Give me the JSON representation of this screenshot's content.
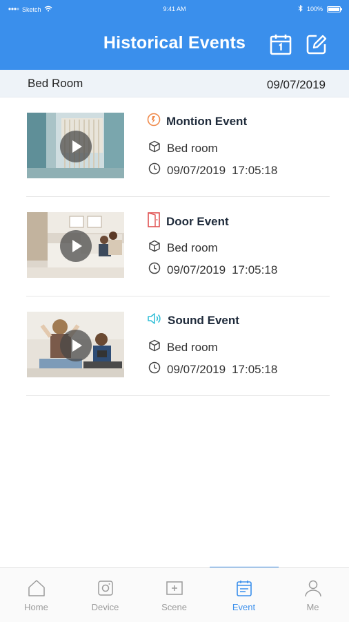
{
  "status_bar": {
    "carrier": "Sketch",
    "time": "9:41 AM",
    "battery": "100%"
  },
  "header": {
    "title": "Historical Events",
    "calendar_icon": "calendar-icon",
    "edit_icon": "edit-icon",
    "color": "#3a8fec"
  },
  "filter": {
    "room": "Bed Room",
    "date": "09/07/2019"
  },
  "events": [
    {
      "type": "Montion Event",
      "icon": "motion-icon",
      "icon_color": "#f08a4b",
      "location": "Bed room",
      "date": "09/07/2019",
      "time": "17:05:18"
    },
    {
      "type": "Door Event",
      "icon": "door-icon",
      "icon_color": "#e05252",
      "location": "Bed room",
      "date": "09/07/2019",
      "time": "17:05:18"
    },
    {
      "type": "Sound Event",
      "icon": "sound-icon",
      "icon_color": "#35c0d8",
      "location": "Bed room",
      "date": "09/07/2019",
      "time": "17:05:18"
    }
  ],
  "tabs": [
    {
      "label": "Home",
      "icon": "home-icon"
    },
    {
      "label": "Device",
      "icon": "device-icon"
    },
    {
      "label": "Scene",
      "icon": "scene-icon"
    },
    {
      "label": "Event",
      "icon": "event-icon",
      "active": true
    },
    {
      "label": "Me",
      "icon": "user-icon"
    }
  ]
}
